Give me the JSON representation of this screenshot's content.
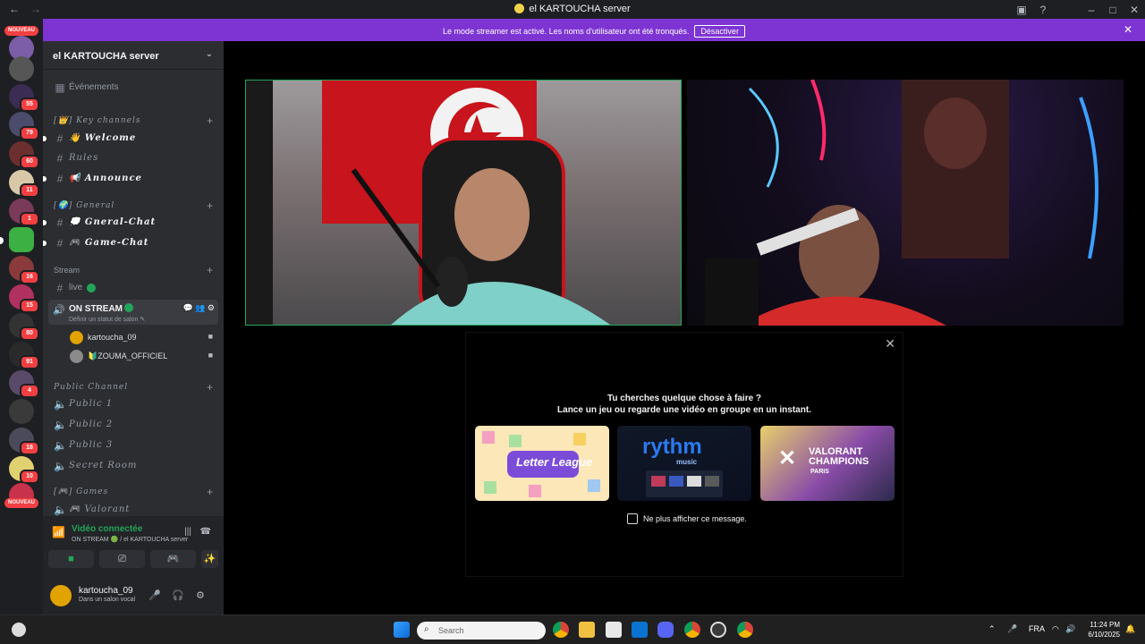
{
  "window": {
    "title": "el KARTOUCHA server"
  },
  "banner": {
    "text": "Le mode streamer est activé. Les noms d'utilisateur ont été tronqués.",
    "button": "Désactiver"
  },
  "servers": {
    "nouveau_top": "NOUVEAU",
    "nouveau_bottom": "NOUVEAU",
    "badges": [
      "55",
      "79",
      "60",
      "11",
      "1",
      "16",
      "15",
      "80",
      "91",
      "4",
      "18",
      "10"
    ]
  },
  "sidebar": {
    "server_name": "el KARTOUCHA server",
    "events": "Événements",
    "cat_key": "[👑] Key channels",
    "welcome": "👋 Welcome",
    "rules": "Rules",
    "announce": "📢 Announce",
    "cat_general": "[🌍] General",
    "gneral_chat": "💭 Gneral-Chat",
    "game_chat": "🎮 Game-Chat",
    "cat_stream": "Stream",
    "live": "live",
    "on_stream": "ON STREAM",
    "on_stream_status": "Définir un statut de salon ✎",
    "user1": "kartoucha_09",
    "user2": "🔰ZOUMA_OFFICIEL",
    "cat_public": "Public Channel",
    "public1": "Public 1",
    "public2": "Public 2",
    "public3": "Public 3",
    "secret": "Secret Room",
    "cat_games": "[🎮] Games",
    "valorant": "🎮 Valorant"
  },
  "voice": {
    "connected": "Vidéo connectée",
    "channel": "ON STREAM 🟢 / el KARTOUCHA server",
    "username": "kartoucha_09",
    "status": "Dans un salon vocal"
  },
  "popup": {
    "line1": "Tu cherches quelque chose à faire ?",
    "line2": "Lance un jeu ou regarde une vidéo en groupe en un instant.",
    "card1": "Letter League",
    "card2": "rythm",
    "card2_sub": "music",
    "card3": "VALORANT CHAMPIONS",
    "card3_sub": "PARIS",
    "checkbox": "Ne plus afficher ce message."
  },
  "taskbar": {
    "search_placeholder": "Search",
    "lang": "FRA",
    "time": "11:24 PM",
    "date": "6/10/2025"
  },
  "colors": {
    "accent": "#7d34d3",
    "online": "#23a559",
    "danger": "#f23f42"
  }
}
